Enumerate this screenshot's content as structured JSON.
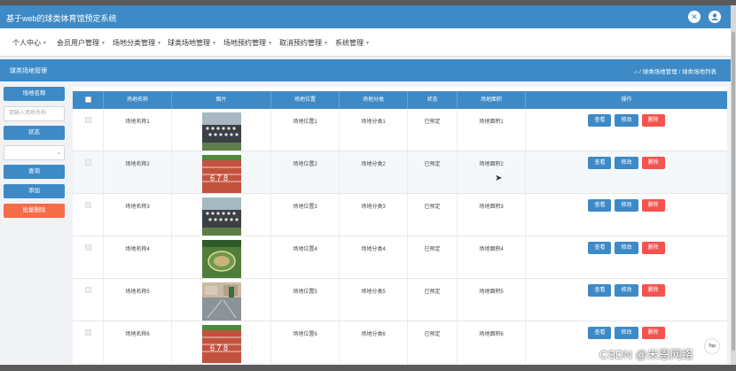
{
  "header": {
    "title": "基于web的球类体育馆预定系统",
    "icons": [
      "close-icon",
      "user-icon"
    ]
  },
  "nav": {
    "items": [
      {
        "label": "个人中心"
      },
      {
        "label": "会员用户管理"
      },
      {
        "label": "场地分类管理"
      },
      {
        "label": "球类场地管理"
      },
      {
        "label": "场地预约管理"
      },
      {
        "label": "取消预约管理"
      },
      {
        "label": "系统管理"
      }
    ],
    "caret": "▼"
  },
  "pagebar": {
    "title": "球类场地管理",
    "home_icon": "home-icon",
    "crumb1": "球类场地管理",
    "crumb2": "球类场地列表",
    "sep": "/"
  },
  "filters": {
    "name_label": "场地名称",
    "name_placeholder": "请输入场地名称",
    "status_label": "状态",
    "status_value": "",
    "search": "查询",
    "add": "添加",
    "batch_delete": "批量删除"
  },
  "table": {
    "headers": [
      "场地名称",
      "图片",
      "场地位置",
      "场地分类",
      "状态",
      "场地面积",
      "操作"
    ],
    "rows": [
      {
        "name": "场地名称1",
        "location": "场地位置1",
        "category": "场地分类1",
        "status": "已预定",
        "area": "场地面积1"
      },
      {
        "name": "场地名称2",
        "location": "场地位置2",
        "category": "场地分类2",
        "status": "已预定",
        "area": "场地面积2"
      },
      {
        "name": "场地名称3",
        "location": "场地位置3",
        "category": "场地分类3",
        "status": "已预定",
        "area": "场地面积3"
      },
      {
        "name": "场地名称4",
        "location": "场地位置4",
        "category": "场地分类4",
        "status": "已预定",
        "area": "场地面积4"
      },
      {
        "name": "场地名称5",
        "location": "场地位置5",
        "category": "场地分类5",
        "status": "已预定",
        "area": "场地面积5"
      },
      {
        "name": "场地名称6",
        "location": "场地位置6",
        "category": "场地分类6",
        "status": "已预定",
        "area": "场地面积6"
      }
    ],
    "actions": {
      "view": "查看",
      "edit": "修改",
      "delete": "删除"
    }
  },
  "top_button": "Top",
  "watermark": "CSDN @米恩网络"
}
